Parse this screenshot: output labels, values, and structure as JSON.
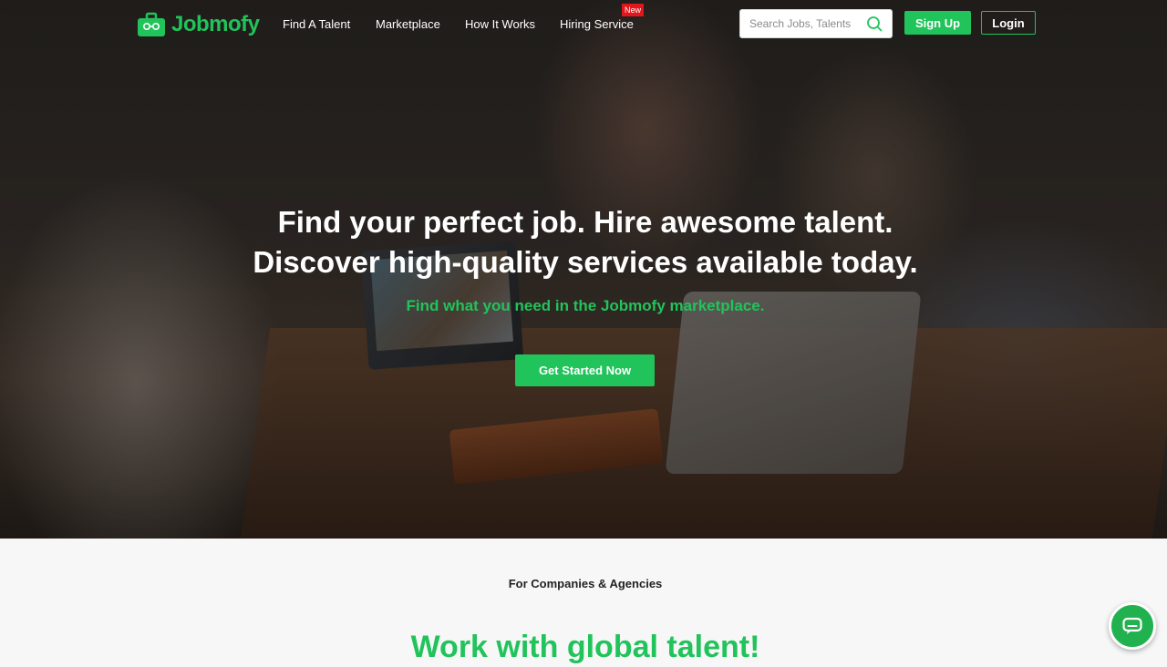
{
  "brand": {
    "name": "Jobmofy",
    "accent_color": "#21c35b",
    "badge_color": "#e0171c"
  },
  "nav": {
    "links": [
      {
        "label": "Find A Talent"
      },
      {
        "label": "Marketplace"
      },
      {
        "label": "How It Works"
      },
      {
        "label": "Hiring Service",
        "badge": "New"
      }
    ],
    "search": {
      "placeholder": "Search Jobs, Talents",
      "icon": "search-icon"
    },
    "signup_label": "Sign Up",
    "login_label": "Login"
  },
  "hero": {
    "headline_line1": "Find your perfect job. Hire awesome talent.",
    "headline_line2": "Discover high-quality services available today.",
    "subheadline": "Find what you need in the Jobmofy marketplace.",
    "cta_label": "Get Started Now"
  },
  "section": {
    "label": "For Companies & Agencies",
    "heading": "Work with global talent!"
  },
  "chat_widget": {
    "icon": "chat-icon"
  }
}
